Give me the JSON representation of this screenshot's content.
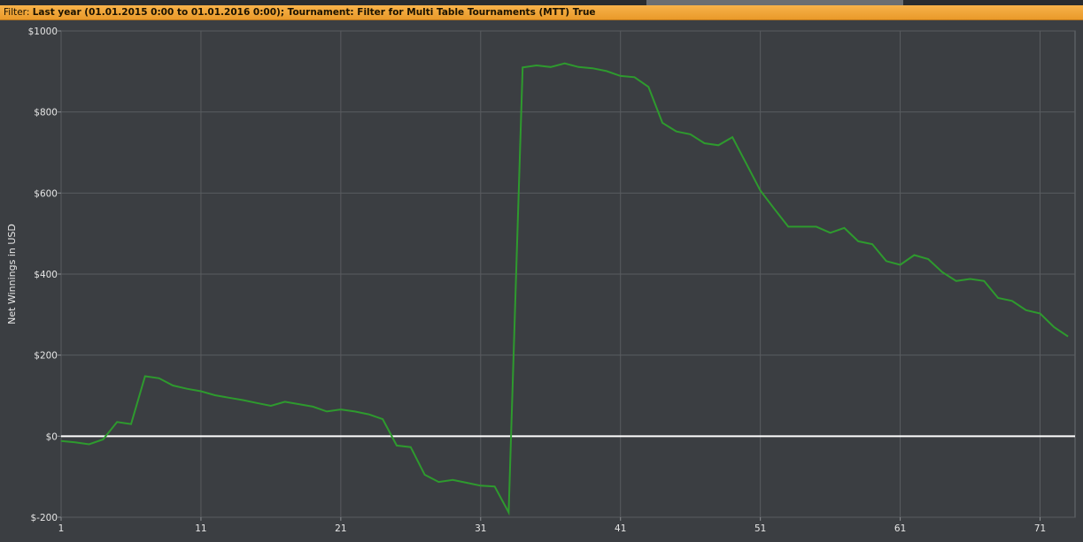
{
  "filter": {
    "label": "Filter:",
    "text": "Last year (01.01.2015 0:00 to 01.01.2016 0:00); Tournament: Filter for Multi Table Tournaments (MTT) True"
  },
  "colors": {
    "background": "#3b3e42",
    "grid": "#595c60",
    "line": "#2e9a2e",
    "zero_line": "#ffffff",
    "filter_bar": "#f2a73b"
  },
  "chart_data": {
    "type": "line",
    "ylabel": "Net Winnings in USD",
    "xlabel": "",
    "ylim": [
      -200,
      1000
    ],
    "xlim": [
      1,
      73.5
    ],
    "x_ticks": [
      1,
      11,
      21,
      31,
      41,
      51,
      61,
      71
    ],
    "y_ticks": [
      -200,
      0,
      200,
      400,
      600,
      800,
      1000
    ],
    "y_tick_labels": [
      "$-200",
      "$0",
      "$200",
      "$400",
      "$600",
      "$800",
      "$1000"
    ],
    "grid": true,
    "series": [
      {
        "x": [
          1,
          2,
          3,
          4,
          5,
          6,
          7,
          8,
          9,
          10,
          11,
          12,
          13,
          14,
          15,
          16,
          17,
          18,
          19,
          20,
          21,
          22,
          23,
          24,
          25,
          26,
          27,
          28,
          29,
          30,
          31,
          32,
          33,
          34,
          35,
          36,
          37,
          38,
          39,
          40,
          41,
          42,
          43,
          44,
          45,
          46,
          47,
          48,
          49,
          50,
          51,
          52,
          53,
          54,
          55,
          56,
          57,
          58,
          59,
          60,
          61,
          62,
          63,
          64,
          65,
          66,
          67,
          68,
          69,
          70,
          71,
          72,
          73
        ],
        "values": [
          -12,
          -15,
          -20,
          -8,
          35,
          30,
          148,
          143,
          125,
          117,
          111,
          101,
          95,
          89,
          82,
          75,
          85,
          79,
          73,
          61,
          66,
          61,
          54,
          42,
          -23,
          -27,
          -95,
          -113,
          -108,
          -115,
          -122,
          -124,
          -188,
          910,
          915,
          911,
          920,
          911,
          908,
          901,
          889,
          886,
          862,
          773,
          752,
          745,
          723,
          718,
          738,
          672,
          606,
          561,
          517,
          517,
          517,
          502,
          514,
          481,
          474,
          432,
          423,
          447,
          437,
          405,
          383,
          388,
          383,
          341,
          334,
          311,
          303,
          269,
          246
        ]
      }
    ]
  }
}
